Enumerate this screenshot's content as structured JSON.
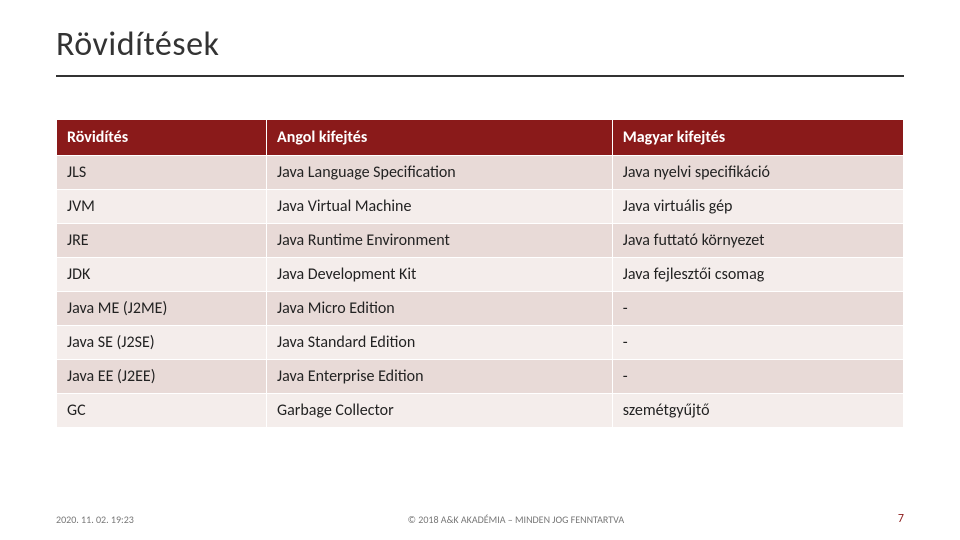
{
  "title": "Rövidítések",
  "table": {
    "headers": [
      "Rövidítés",
      "Angol kifejtés",
      "Magyar kifejtés"
    ],
    "rows": [
      [
        "JLS",
        "Java Language Specification",
        "Java nyelvi specifikáció"
      ],
      [
        "JVM",
        "Java Virtual Machine",
        "Java virtuális gép"
      ],
      [
        "JRE",
        "Java Runtime Environment",
        "Java futtató környezet"
      ],
      [
        "JDK",
        "Java Development Kit",
        "Java fejlesztői csomag"
      ],
      [
        "Java ME (J2ME)",
        "Java Micro Edition",
        "-"
      ],
      [
        "Java SE (J2SE)",
        "Java Standard Edition",
        "-"
      ],
      [
        "Java EE (J2EE)",
        "Java Enterprise Edition",
        "-"
      ],
      [
        "GC",
        "Garbage Collector",
        "szemétgyűjtő"
      ]
    ]
  },
  "footer": {
    "timestamp": "2020. 11. 02. 19:23",
    "copyright": "© 2018 A&K AKADÉMIA – MINDEN JOG FENNTARTVA",
    "page_number": "7"
  }
}
